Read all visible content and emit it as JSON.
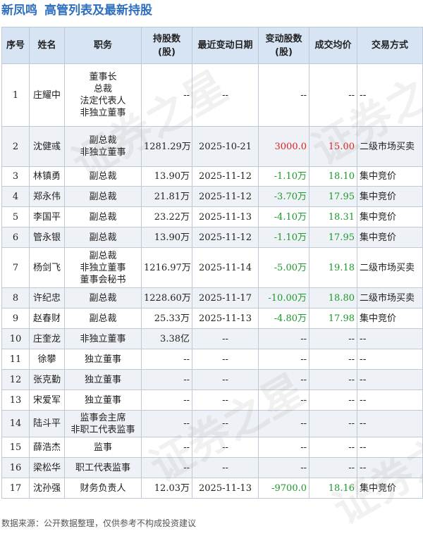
{
  "header": {
    "stock_name": "新凤鸣",
    "title": "高管列表及最新持股"
  },
  "columns": [
    "序号",
    "姓名",
    "职务",
    "持股数(股)",
    "最近变动日期",
    "变动股数(股)",
    "成交均价",
    "交易方式"
  ],
  "rows": [
    {
      "no": "1",
      "name": "庄耀中",
      "positions": [
        "董事长",
        "总裁",
        "法定代表人",
        "非独立董事"
      ],
      "shares": "--",
      "date": "--",
      "change": "--",
      "price": "--",
      "method": "--",
      "change_color": "",
      "price_color": ""
    },
    {
      "no": "2",
      "name": "沈健彧",
      "positions": [
        "副总裁",
        "非独立董事"
      ],
      "shares": "1281.29万",
      "date": "2025-10-21",
      "change": "3000.0",
      "price": "15.00",
      "method": "二级市场买卖",
      "change_color": "red",
      "price_color": "red"
    },
    {
      "no": "3",
      "name": "林镇勇",
      "positions": [
        "副总裁"
      ],
      "shares": "13.90万",
      "date": "2025-11-12",
      "change": "-1.10万",
      "price": "18.10",
      "method": "集中竞价",
      "change_color": "green",
      "price_color": "green"
    },
    {
      "no": "4",
      "name": "郑永伟",
      "positions": [
        "副总裁"
      ],
      "shares": "21.81万",
      "date": "2025-11-12",
      "change": "-3.70万",
      "price": "17.95",
      "method": "集中竞价",
      "change_color": "green",
      "price_color": "green"
    },
    {
      "no": "5",
      "name": "李国平",
      "positions": [
        "副总裁"
      ],
      "shares": "23.22万",
      "date": "2025-11-13",
      "change": "-4.10万",
      "price": "18.31",
      "method": "集中竞价",
      "change_color": "green",
      "price_color": "green"
    },
    {
      "no": "6",
      "name": "管永银",
      "positions": [
        "副总裁"
      ],
      "shares": "13.90万",
      "date": "2025-11-12",
      "change": "-1.10万",
      "price": "17.95",
      "method": "集中竞价",
      "change_color": "green",
      "price_color": "green"
    },
    {
      "no": "7",
      "name": "杨剑飞",
      "positions": [
        "副总裁",
        "非独立董事",
        "董事会秘书"
      ],
      "shares": "1216.97万",
      "date": "2025-11-14",
      "change": "-5.00万",
      "price": "19.18",
      "method": "二级市场买卖",
      "change_color": "green",
      "price_color": "green"
    },
    {
      "no": "8",
      "name": "许纪忠",
      "positions": [
        "副总裁"
      ],
      "shares": "1228.60万",
      "date": "2025-11-17",
      "change": "-10.00万",
      "price": "18.80",
      "method": "二级市场买卖",
      "change_color": "green",
      "price_color": "green"
    },
    {
      "no": "9",
      "name": "赵春财",
      "positions": [
        "副总裁"
      ],
      "shares": "25.33万",
      "date": "2025-11-13",
      "change": "-4.80万",
      "price": "17.98",
      "method": "集中竞价",
      "change_color": "green",
      "price_color": "green"
    },
    {
      "no": "10",
      "name": "庄奎龙",
      "positions": [
        "非独立董事"
      ],
      "shares": "3.38亿",
      "date": "--",
      "change": "--",
      "price": "--",
      "method": "--",
      "change_color": "",
      "price_color": ""
    },
    {
      "no": "11",
      "name": "徐攀",
      "positions": [
        "独立董事"
      ],
      "shares": "--",
      "date": "--",
      "change": "--",
      "price": "--",
      "method": "--",
      "change_color": "",
      "price_color": ""
    },
    {
      "no": "12",
      "name": "张克勤",
      "positions": [
        "独立董事"
      ],
      "shares": "--",
      "date": "--",
      "change": "--",
      "price": "--",
      "method": "--",
      "change_color": "",
      "price_color": ""
    },
    {
      "no": "13",
      "name": "宋爱军",
      "positions": [
        "独立董事"
      ],
      "shares": "--",
      "date": "--",
      "change": "--",
      "price": "--",
      "method": "--",
      "change_color": "",
      "price_color": ""
    },
    {
      "no": "14",
      "name": "陆斗平",
      "positions": [
        "监事会主席",
        "非职工代表监事"
      ],
      "shares": "--",
      "date": "--",
      "change": "--",
      "price": "--",
      "method": "--",
      "change_color": "",
      "price_color": ""
    },
    {
      "no": "15",
      "name": "薛浩杰",
      "positions": [
        "监事"
      ],
      "shares": "--",
      "date": "--",
      "change": "--",
      "price": "--",
      "method": "--",
      "change_color": "",
      "price_color": ""
    },
    {
      "no": "16",
      "name": "梁松华",
      "positions": [
        "职工代表监事"
      ],
      "shares": "--",
      "date": "--",
      "change": "--",
      "price": "--",
      "method": "--",
      "change_color": "",
      "price_color": ""
    },
    {
      "no": "17",
      "name": "沈孙强",
      "positions": [
        "财务负责人"
      ],
      "shares": "12.03万",
      "date": "2025-11-13",
      "change": "-9700.0",
      "price": "18.16",
      "method": "集中竞价",
      "change_color": "green",
      "price_color": "green"
    }
  ],
  "footer": "数据来源：公开数据整理，仅供参考不构成投资建议",
  "watermark": "证券之星",
  "colors": {
    "title": "#2f6fbf",
    "header_bg": "#d7e4f4",
    "up": "#e02020",
    "down": "#1a9a2a"
  }
}
